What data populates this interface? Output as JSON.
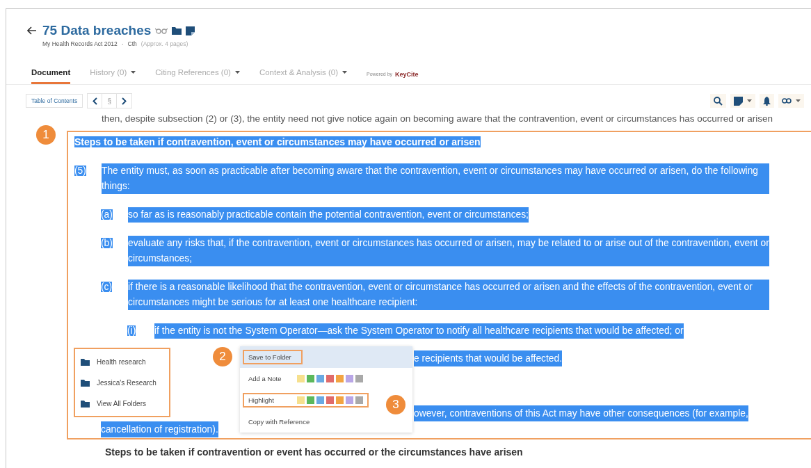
{
  "header": {
    "title": "75 Data breaches",
    "subtitle": [
      "My Health Records Act 2012",
      "·",
      "Cth",
      "(Approx. 4 pages)"
    ]
  },
  "tabs": [
    {
      "label": "Document",
      "selected": true,
      "dropdown": false
    },
    {
      "label": "History (0)",
      "selected": false,
      "dropdown": true
    },
    {
      "label": "Citing References (0)",
      "selected": false,
      "dropdown": true
    },
    {
      "label": "Context & Analysis (0)",
      "selected": false,
      "dropdown": true
    }
  ],
  "powered_by": {
    "label": "Powered by",
    "brand": "KeyCite"
  },
  "toolbar": {
    "toc_button": "Table of Contents",
    "section_button": "§"
  },
  "document": {
    "lead_text": "then, despite subsection (2) or (3), the entity need not give notice again on becoming aware that the contravention, event or circumstances has occurred or arisen",
    "callout": "1",
    "heading": {
      "text": "Steps to be taken if contravention, event or circumstances may have occurred or arisen",
      "selected": true
    },
    "provisions": [
      {
        "marker": "(5)",
        "text": "The entity must, as soon as practicable after becoming aware that the contravention, event or circumstances may have occurred or arisen, do the following things:",
        "selected": true,
        "children": [
          {
            "marker": "(a)",
            "text": "so far as is reasonably practicable contain the potential contravention, event or circumstances;",
            "selected": true
          },
          {
            "marker": "(b)",
            "text": "evaluate any risks that, if the contravention, event or circumstances has occurred or arisen, may be related to or arise out of the contravention, event or circumstances;",
            "selected": true
          },
          {
            "marker": "(c)",
            "text": "if there is a reasonable likelihood that the contravention, event or circumstance has occurred or arisen and the effects of the contravention, event or circumstances might be serious for at least one healthcare recipient:",
            "selected": true,
            "children": [
              {
                "marker": "(i)",
                "text": "if the entity is not the System Operator—ask the System Operator to notify all healthcare recipients that would be affected; or",
                "selected": true
              }
            ]
          }
        ]
      }
    ],
    "partial_lines": [
      {
        "kind": "covered",
        "text": "e recipients that would be affected.",
        "selected": true
      },
      {
        "kind": "covered",
        "text": "owever, contraventions of this Act may have other consequences (for example,",
        "selected": true
      },
      {
        "kind": "continued",
        "text": "cancellation of registration).",
        "selected": true
      }
    ],
    "next_heading": "Steps to be taken if contravention or event has occurred or the circumstances have arisen"
  },
  "folder_menu": {
    "items": [
      "Health research",
      "Jessica's Research",
      "View All Folders"
    ]
  },
  "context_menu": {
    "callouts": [
      "2",
      "3"
    ],
    "items": [
      {
        "kind": "action",
        "label": "Save to Folder",
        "selected": true,
        "outlined": true
      },
      {
        "kind": "palette",
        "label": "Add a Note",
        "selected": false,
        "outlined": false,
        "swatches": [
          {
            "color": "#f6e08e"
          },
          {
            "color": "#5cb85c"
          },
          {
            "color": "#6aa9e2"
          },
          {
            "color": "#e06b6b"
          },
          {
            "color": "#f2a443"
          },
          {
            "color": "#b9a6e6"
          },
          {
            "color": "#a9a9a9"
          }
        ]
      },
      {
        "kind": "palette",
        "label": "Highlight",
        "selected": false,
        "outlined": true,
        "swatches": [
          {
            "color": "#f6e08e"
          },
          {
            "color": "#5cb85c"
          },
          {
            "color": "#6aa9e2"
          },
          {
            "color": "#e06b6b"
          },
          {
            "color": "#f2a443"
          },
          {
            "color": "#b9a6e6"
          },
          {
            "color": "#a9a9a9"
          }
        ]
      },
      {
        "kind": "action",
        "label": "Copy with Reference",
        "selected": false,
        "outlined": false
      }
    ]
  }
}
